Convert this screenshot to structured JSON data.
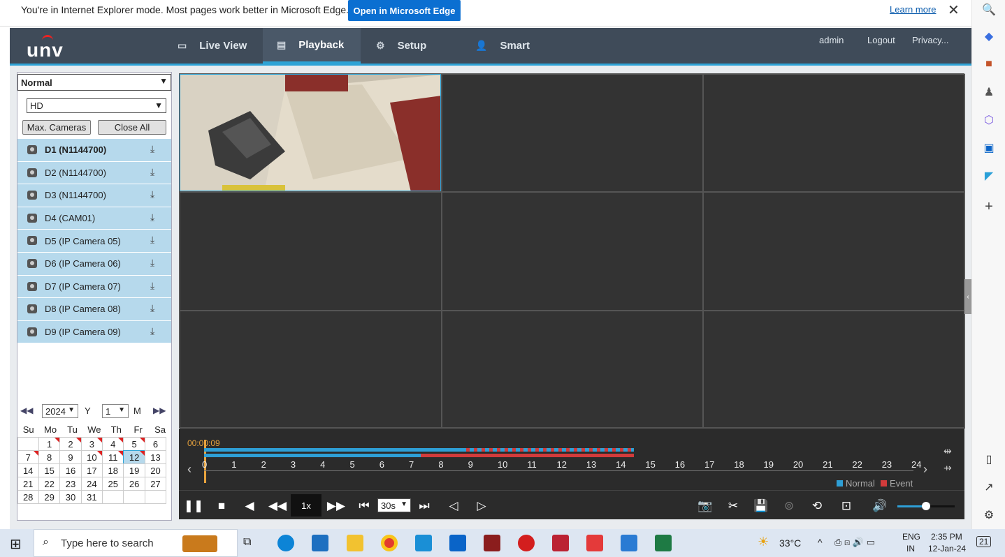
{
  "ie_banner": {
    "message": "You're in Internet Explorer mode. Most pages work better in Microsoft Edge.",
    "open_button": "Open in Microsoft Edge",
    "learn_more": "Learn more"
  },
  "header": {
    "logo": "unv",
    "nav": [
      {
        "label": "Live View",
        "icon": "monitor-icon"
      },
      {
        "label": "Playback",
        "icon": "film-icon"
      },
      {
        "label": "Setup",
        "icon": "gear-icon"
      },
      {
        "label": "Smart",
        "icon": "person-icon"
      }
    ],
    "user": "admin",
    "logout": "Logout",
    "privacy": "Privacy..."
  },
  "left": {
    "mode_select": "Normal",
    "quality_select": "HD",
    "max_cameras": "Max. Cameras",
    "close_all": "Close All",
    "cameras": [
      "D1 (N1144700)",
      "D2 (N1144700)",
      "D3 (N1144700)",
      "D4 (CAM01)",
      "D5 (IP Camera 05)",
      "D6 (IP Camera 06)",
      "D7 (IP Camera 07)",
      "D8 (IP Camera 08)",
      "D9 (IP Camera 09)"
    ]
  },
  "calendar": {
    "year": "2024",
    "year_label": "Y",
    "month": "1",
    "month_label": "M",
    "weekdays": [
      "Su",
      "Mo",
      "Tu",
      "We",
      "Th",
      "Fr",
      "Sa"
    ],
    "weeks": [
      [
        "",
        "1",
        "2",
        "3",
        "4",
        "5",
        "6"
      ],
      [
        "7",
        "8",
        "9",
        "10",
        "11",
        "12",
        "13"
      ],
      [
        "14",
        "15",
        "16",
        "17",
        "18",
        "19",
        "20"
      ],
      [
        "21",
        "22",
        "23",
        "24",
        "25",
        "26",
        "27"
      ],
      [
        "28",
        "29",
        "30",
        "31",
        "",
        "",
        ""
      ]
    ],
    "today": "12",
    "marked_days": [
      "1",
      "2",
      "3",
      "4",
      "5",
      "7",
      "10",
      "11",
      "12"
    ]
  },
  "timeline": {
    "current_time": "00:00:09",
    "hours": [
      "0",
      "1",
      "2",
      "3",
      "4",
      "5",
      "6",
      "7",
      "8",
      "9",
      "10",
      "11",
      "12",
      "13",
      "14",
      "15",
      "16",
      "17",
      "18",
      "19",
      "20",
      "21",
      "22",
      "23",
      "24"
    ],
    "legend_normal": "Normal",
    "legend_event": "Event",
    "speed": "1x",
    "interval": "30s",
    "normal_color": "#2e9fd6",
    "event_color": "#d23b3b",
    "volume_level": 0.5
  },
  "taskbar": {
    "search_placeholder": "Type here to search",
    "weather": "33°C",
    "lang1": "ENG",
    "lang2": "IN",
    "time": "2:35 PM",
    "date": "12-Jan-24",
    "notifications": "21"
  }
}
